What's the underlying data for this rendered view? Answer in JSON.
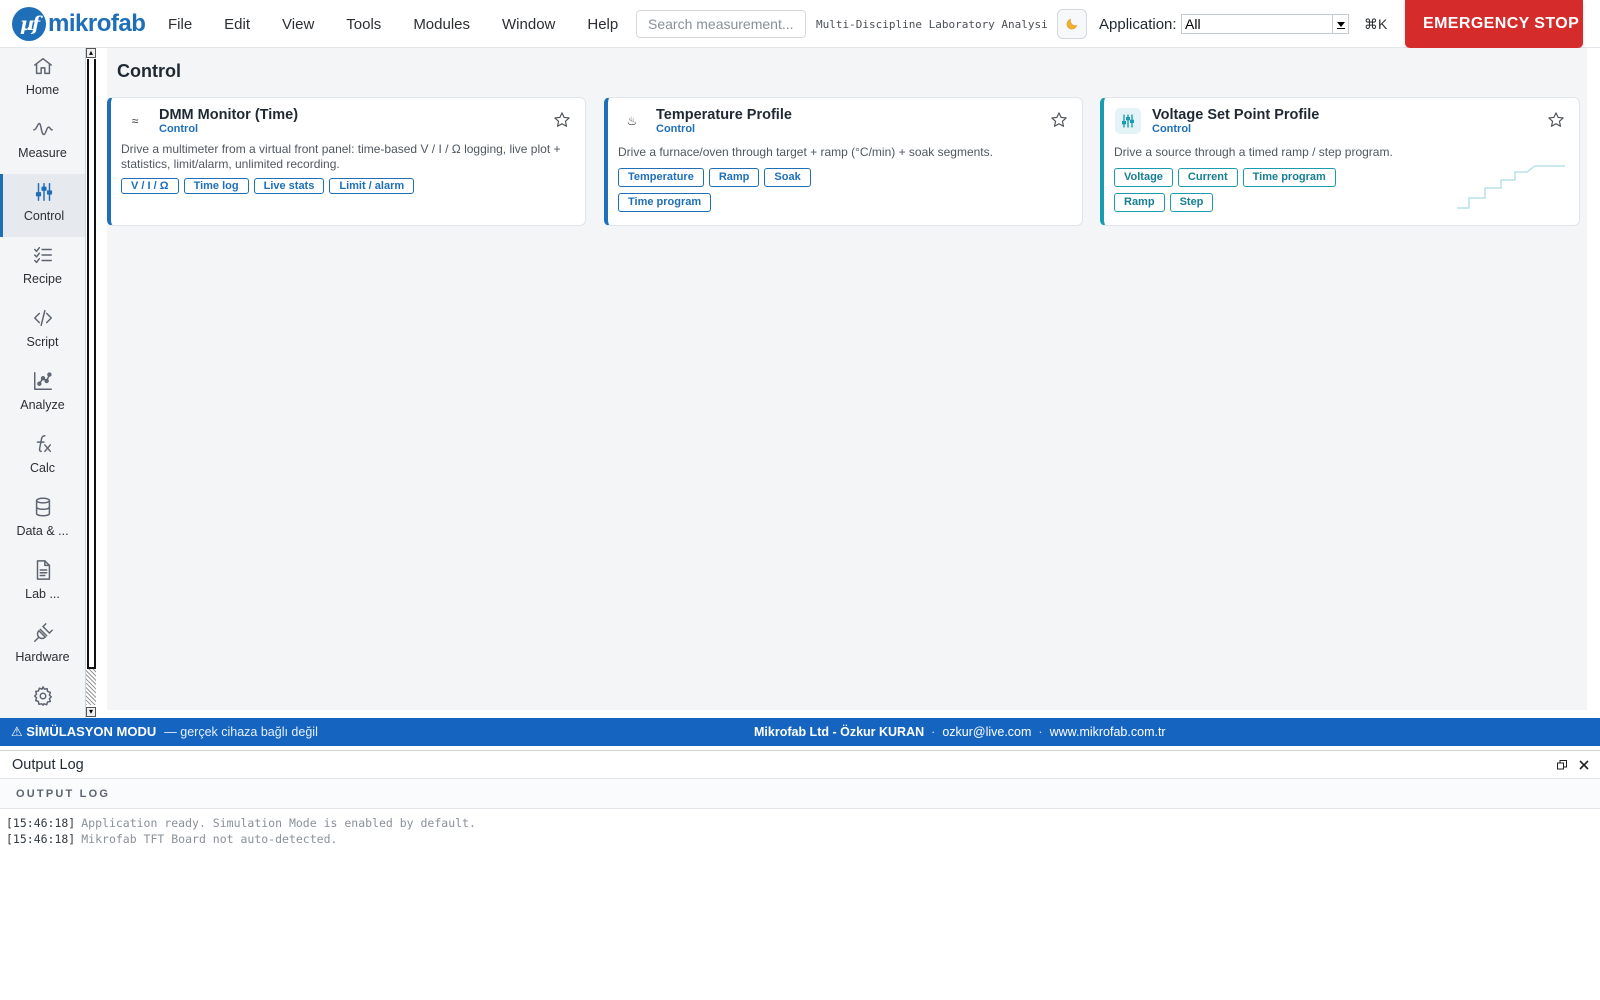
{
  "brand": {
    "logo_glyph": "µf",
    "name": "mikrofab",
    "color": "#1e6fb8"
  },
  "menu": [
    "File",
    "Edit",
    "View",
    "Tools",
    "Modules",
    "Window",
    "Help"
  ],
  "search": {
    "placeholder": "Search measurement..."
  },
  "app_title": "Multi-Discipline Laboratory Analysis",
  "theme_toggle_icon": "moon-icon",
  "application": {
    "label": "Application:",
    "selected": "All"
  },
  "shortcut": "⌘K",
  "emergency_stop": {
    "label": "EMERGENCY STOP",
    "color": "#d62b2b"
  },
  "sidebar": {
    "items": [
      {
        "label": "Home",
        "icon": "home-icon"
      },
      {
        "label": "Measure",
        "icon": "pulse-icon"
      },
      {
        "label": "Control",
        "icon": "sliders-icon",
        "active": true
      },
      {
        "label": "Recipe",
        "icon": "checklist-icon"
      },
      {
        "label": "Script",
        "icon": "code-icon"
      },
      {
        "label": "Analyze",
        "icon": "scatter-chart-icon"
      },
      {
        "label": "Calc",
        "icon": "function-icon"
      },
      {
        "label": "Data & ...",
        "icon": "database-icon"
      },
      {
        "label": "Lab ...",
        "icon": "document-icon"
      },
      {
        "label": "Hardware",
        "icon": "plug-icon"
      },
      {
        "label": "",
        "icon": "gear-icon"
      }
    ]
  },
  "main": {
    "title": "Control",
    "cards": [
      {
        "icon": "wave-icon",
        "icon_glyph": "≈",
        "title": "DMM Monitor (Time)",
        "category": "Control",
        "description": "Drive a multimeter from a virtual front panel: time-based V / I / Ω logging, live plot + statistics, limit/alarm, unlimited recording.",
        "tags": [
          "V / I / Ω",
          "Time log",
          "Live stats",
          "Limit / alarm"
        ]
      },
      {
        "icon": "flame-icon",
        "icon_glyph": "♨",
        "title": "Temperature Profile",
        "category": "Control",
        "description": "Drive a furnace/oven through target + ramp (°C/min) + soak segments.",
        "tags": [
          "Temperature",
          "Ramp",
          "Soak",
          "Time program"
        ]
      },
      {
        "icon": "sliders-icon",
        "title": "Voltage Set Point Profile",
        "category": "Control",
        "description": "Drive a source through a timed ramp / step program.",
        "tags": [
          "Voltage",
          "Current",
          "Time program",
          "Ramp",
          "Step"
        ],
        "preview_icon": "step-profile-icon"
      }
    ]
  },
  "statusbar": {
    "mode": "⚠ SİMÜLASYON MODU",
    "mode_sub": "— gerçek cihaza bağlı değil",
    "company": "Mikrofab Ltd - Özkur KURAN",
    "separator": "·",
    "email": "ozkur@live.com",
    "website": "www.mikrofab.com.tr",
    "color": "#1565c0"
  },
  "output_log": {
    "title": "Output Log",
    "section_label": "OUTPUT LOG",
    "restore_icon": "restore-window-icon",
    "close_icon": "close-icon",
    "lines": [
      {
        "time": "[15:46:18]",
        "msg": "Application ready. Simulation Mode is enabled by default."
      },
      {
        "time": "[15:46:18]",
        "msg": "Mikrofab TFT Board not auto-detected."
      }
    ]
  }
}
